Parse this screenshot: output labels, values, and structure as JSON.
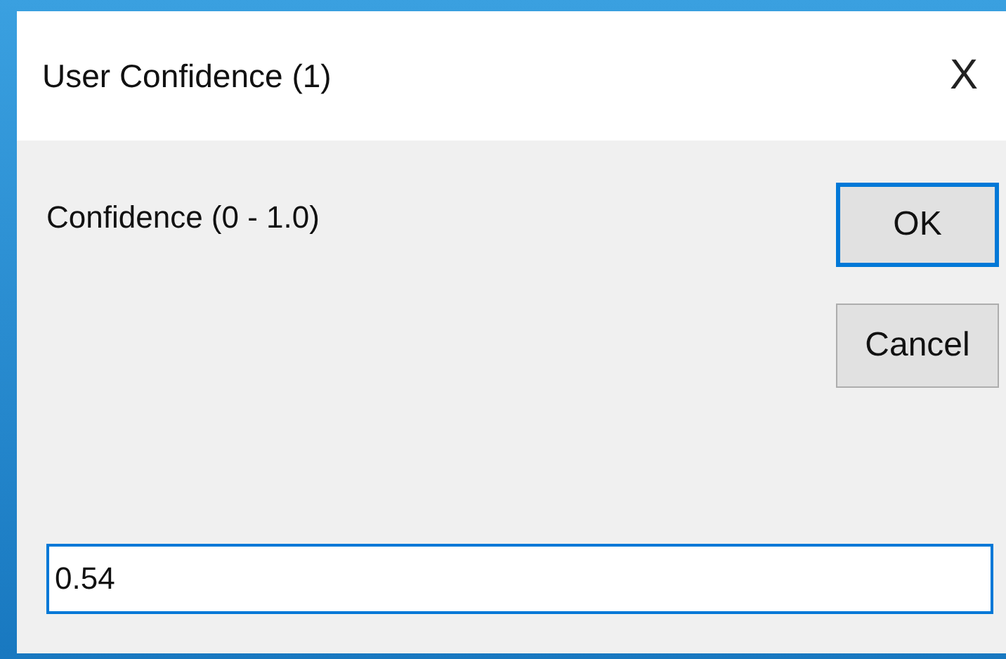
{
  "window": {
    "title": "User Confidence (1)",
    "close": "X"
  },
  "prompt": {
    "label": "Confidence (0 - 1.0)"
  },
  "buttons": [
    {
      "label": "OK",
      "default": true
    },
    {
      "label": "Cancel",
      "default": false
    }
  ],
  "input": {
    "value": "0.54"
  }
}
